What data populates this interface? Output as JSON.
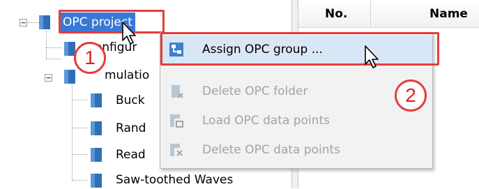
{
  "tree": {
    "root": {
      "label": "OPC project",
      "expander": "⊟"
    },
    "items": [
      {
        "label": "Configur"
      },
      {
        "label": "mulatio",
        "expander": "⊟"
      },
      {
        "label": "Buck"
      },
      {
        "label": "Rand"
      },
      {
        "label": "Read"
      },
      {
        "label": "Saw-toothed Waves"
      }
    ]
  },
  "table": {
    "columns": [
      {
        "label": "No."
      },
      {
        "label": "Name"
      }
    ]
  },
  "context_menu": {
    "items": [
      {
        "label": "Assign OPC group ...",
        "enabled": true,
        "icon": "assign-group-icon"
      },
      {
        "label": "Delete OPC folder",
        "enabled": false,
        "icon": "delete-folder-icon"
      },
      {
        "label": "Load OPC data points",
        "enabled": false,
        "icon": "load-points-icon"
      },
      {
        "label": "Delete OPC data points",
        "enabled": false,
        "icon": "delete-points-icon"
      }
    ]
  },
  "annotations": {
    "step1": "1",
    "step2": "2",
    "highlight_color": "#e53d3d"
  },
  "colors": {
    "selection": "#3a78d6",
    "folder_icon": "#2e6fb7",
    "menu_hover": "#d9e6f5"
  }
}
